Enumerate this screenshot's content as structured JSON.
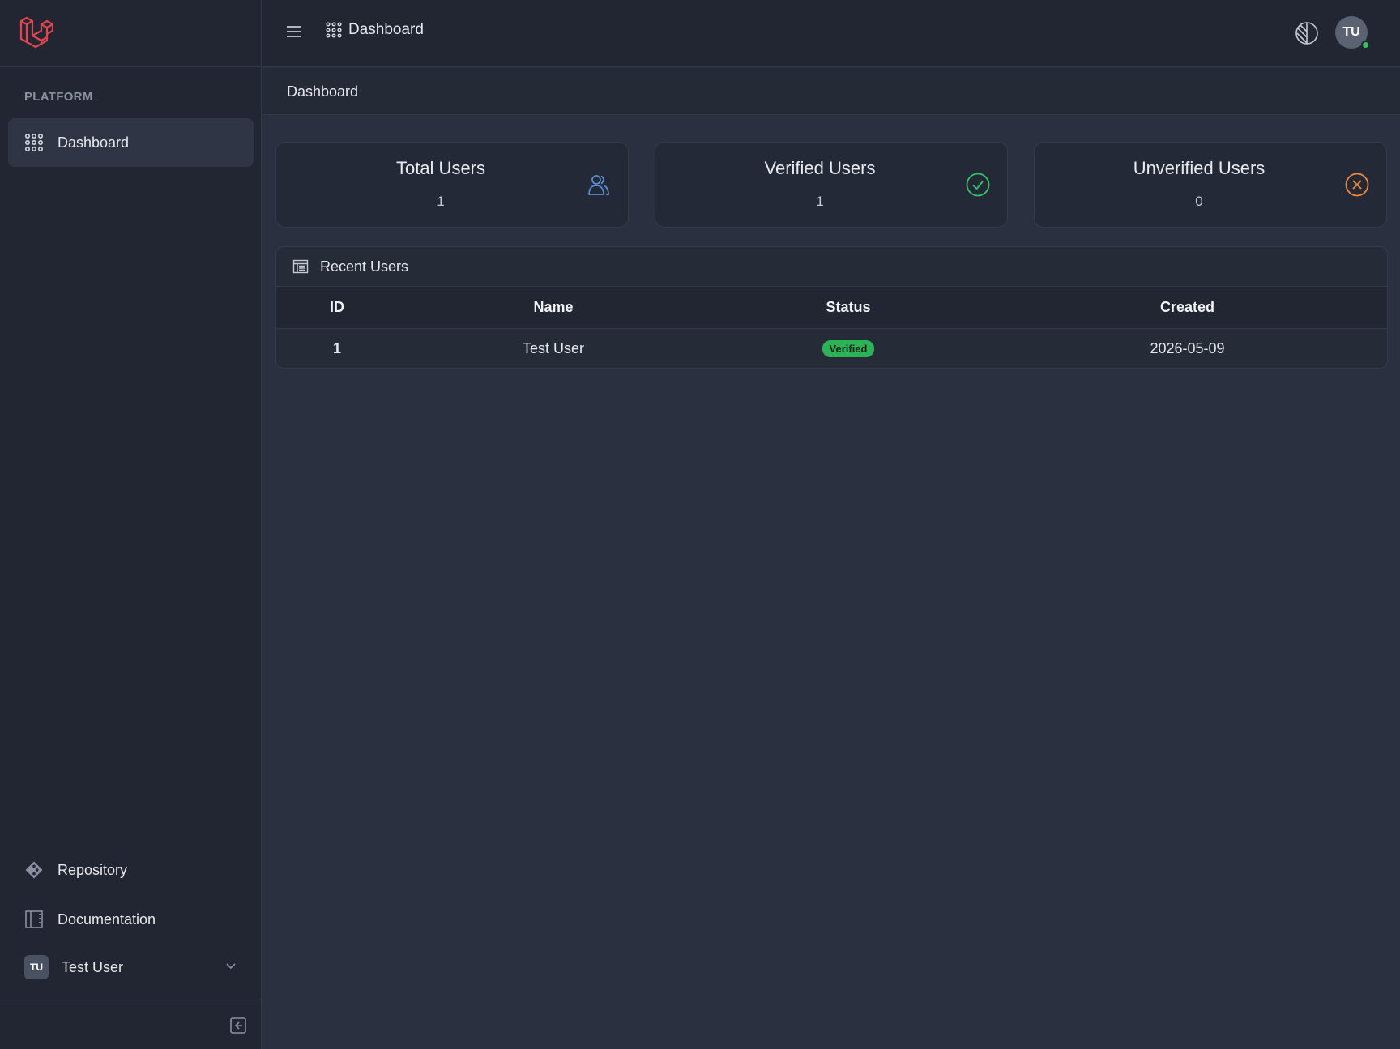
{
  "sidebar": {
    "section_label": "PLATFORM",
    "nav": [
      {
        "label": "Dashboard",
        "icon": "grid-icon",
        "active": true
      }
    ],
    "footer_links": [
      {
        "label": "Repository",
        "icon": "git-icon"
      },
      {
        "label": "Documentation",
        "icon": "book-icon"
      }
    ],
    "user": {
      "initials": "TU",
      "name": "Test User"
    }
  },
  "header": {
    "title": "Dashboard",
    "avatar_initials": "TU",
    "breadcrumb": "Dashboard"
  },
  "stats": [
    {
      "title": "Total Users",
      "value": "1",
      "icon": "users-icon",
      "color": "#5a8fd8"
    },
    {
      "title": "Verified Users",
      "value": "1",
      "icon": "check-circle-icon",
      "color": "#33c466"
    },
    {
      "title": "Unverified Users",
      "value": "0",
      "icon": "x-circle-icon",
      "color": "#f08a3c"
    }
  ],
  "recent_users": {
    "title": "Recent Users",
    "columns": [
      "ID",
      "Name",
      "Status",
      "Created"
    ],
    "rows": [
      {
        "id": "1",
        "name": "Test User",
        "status": "Verified",
        "created": "2026-05-09"
      }
    ]
  },
  "colors": {
    "accent_red": "#e0464f",
    "verified_green": "#2cb357",
    "online_green": "#31c653"
  }
}
